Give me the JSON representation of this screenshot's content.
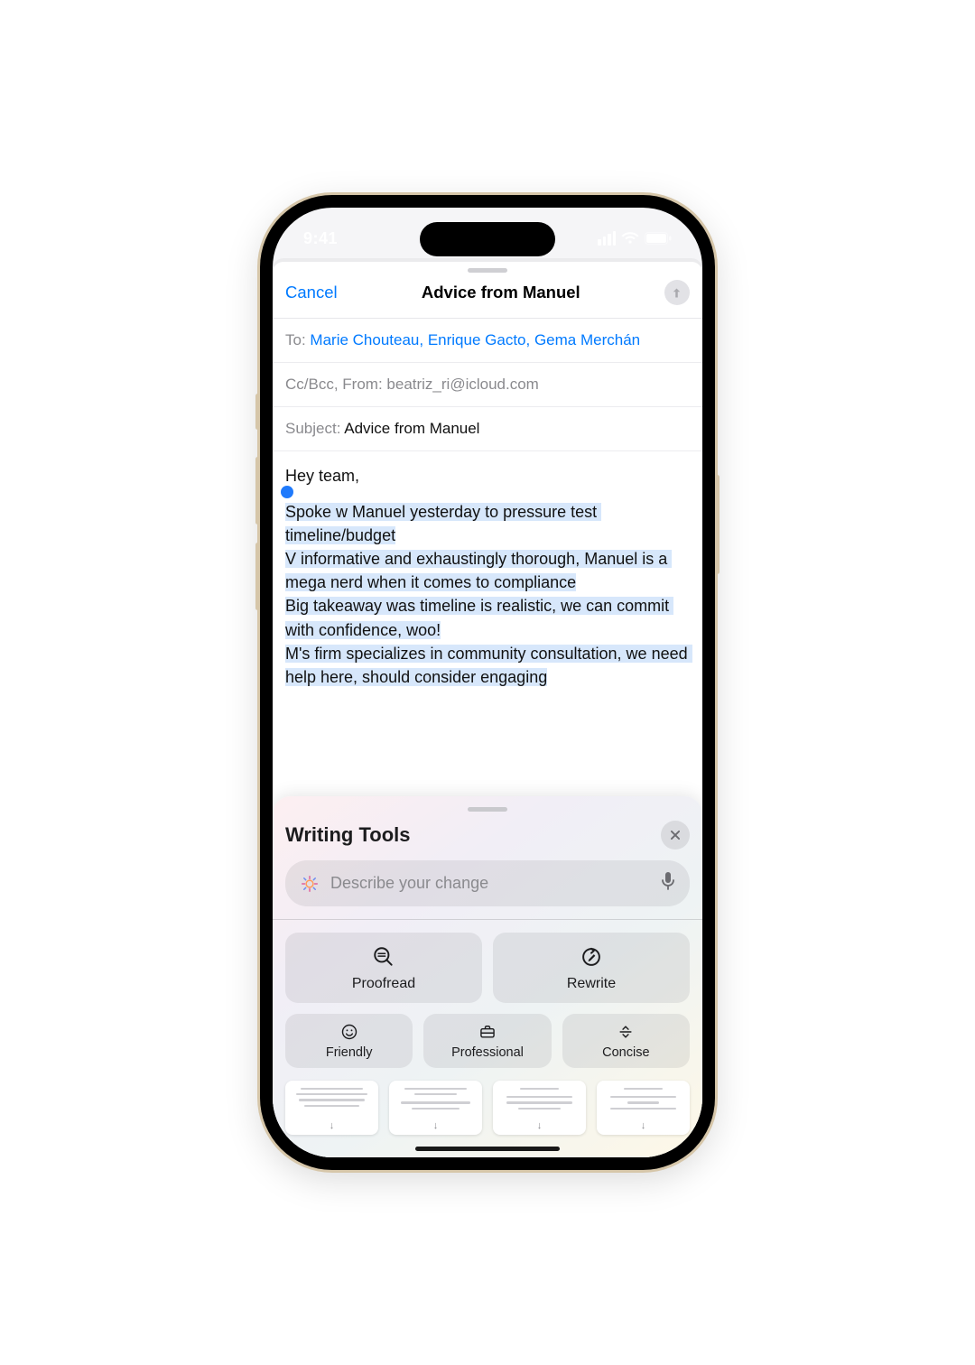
{
  "status": {
    "time": "9:41"
  },
  "compose": {
    "cancel": "Cancel",
    "title": "Advice from Manuel",
    "to_label": "To:",
    "to_value": "Marie Chouteau, Enrique Gacto, Gema Merchán",
    "ccbcc_label": "Cc/Bcc, From:",
    "from_value": "beatriz_ri@icloud.com",
    "subject_label": "Subject:",
    "subject_value": "Advice from Manuel",
    "body_intro": "Hey team,",
    "body_selected": "Spoke w Manuel yesterday to pressure test timeline/budget\nV informative and exhaustingly thorough, Manuel is a mega nerd when it comes to compliance\nBig takeaway was timeline is realistic, we can commit with confidence, woo!\nM's firm specializes in community consultation, we need help here, should consider engaging"
  },
  "tools": {
    "title": "Writing Tools",
    "placeholder": "Describe your change",
    "proofread": "Proofread",
    "rewrite": "Rewrite",
    "friendly": "Friendly",
    "professional": "Professional",
    "concise": "Concise"
  }
}
